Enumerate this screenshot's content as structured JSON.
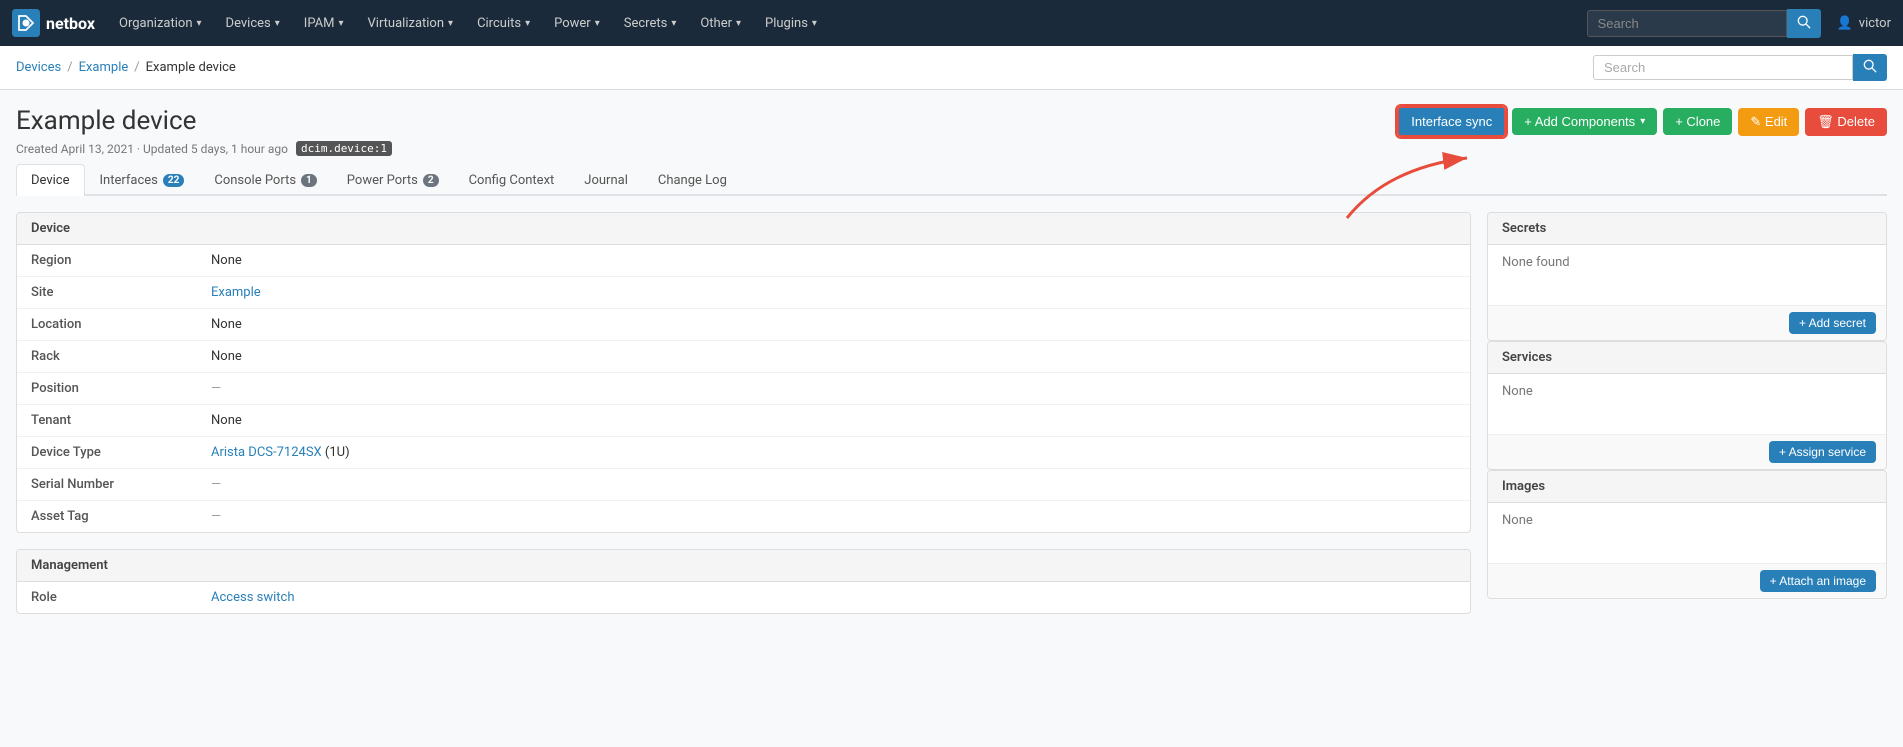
{
  "app": {
    "logo_text": "netbox",
    "nav_items": [
      {
        "label": "Organization",
        "has_dropdown": true
      },
      {
        "label": "Devices",
        "has_dropdown": true
      },
      {
        "label": "IPAM",
        "has_dropdown": true
      },
      {
        "label": "Virtualization",
        "has_dropdown": true
      },
      {
        "label": "Circuits",
        "has_dropdown": true
      },
      {
        "label": "Power",
        "has_dropdown": true
      },
      {
        "label": "Secrets",
        "has_dropdown": true
      },
      {
        "label": "Other",
        "has_dropdown": true
      },
      {
        "label": "Plugins",
        "has_dropdown": true
      }
    ],
    "nav_search_placeholder": "Search",
    "user": "victor"
  },
  "breadcrumb": {
    "items": [
      "Devices",
      "Example",
      "Example device"
    ],
    "links": [
      true,
      true,
      false
    ]
  },
  "sub_search_placeholder": "Search",
  "page": {
    "title": "Example device",
    "meta": "Created April 13, 2021 · Updated 5 days, 1 hour ago",
    "dcim_badge": "dcim.device:1"
  },
  "actions": {
    "interface_sync": "Interface sync",
    "add_components": "+ Add Components",
    "clone": "+ Clone",
    "edit": "✎ Edit",
    "delete": "🗑 Delete"
  },
  "tabs": [
    {
      "label": "Device",
      "badge": null,
      "active": true
    },
    {
      "label": "Interfaces",
      "badge": "22",
      "active": false
    },
    {
      "label": "Console Ports",
      "badge": "1",
      "active": false
    },
    {
      "label": "Power Ports",
      "badge": "2",
      "active": false
    },
    {
      "label": "Config Context",
      "badge": null,
      "active": false
    },
    {
      "label": "Journal",
      "badge": null,
      "active": false
    },
    {
      "label": "Change Log",
      "badge": null,
      "active": false
    }
  ],
  "device_table": {
    "heading": "Device",
    "rows": [
      {
        "label": "Region",
        "value": "None",
        "type": "text"
      },
      {
        "label": "Site",
        "value": "Example",
        "type": "link"
      },
      {
        "label": "Location",
        "value": "None",
        "type": "text"
      },
      {
        "label": "Rack",
        "value": "None",
        "type": "text"
      },
      {
        "label": "Position",
        "value": "—",
        "type": "dash"
      },
      {
        "label": "Tenant",
        "value": "None",
        "type": "text"
      },
      {
        "label": "Device Type",
        "value": "Arista DCS-7124SX (1U)",
        "value_link": "Arista DCS-7124SX",
        "type": "link_suffix",
        "suffix": " (1U)"
      },
      {
        "label": "Serial Number",
        "value": "—",
        "type": "dash"
      },
      {
        "label": "Asset Tag",
        "value": "—",
        "type": "dash"
      }
    ]
  },
  "management_table": {
    "heading": "Management",
    "rows": [
      {
        "label": "Role",
        "value": "Access switch",
        "type": "link"
      }
    ]
  },
  "right_panels": [
    {
      "id": "secrets",
      "heading": "Secrets",
      "body_text": "None found",
      "footer_btn": "+ Add secret"
    },
    {
      "id": "services",
      "heading": "Services",
      "body_text": "None",
      "footer_btn": "+ Assign service"
    },
    {
      "id": "images",
      "heading": "Images",
      "body_text": "None",
      "footer_btn": "+ Attach an image"
    }
  ]
}
